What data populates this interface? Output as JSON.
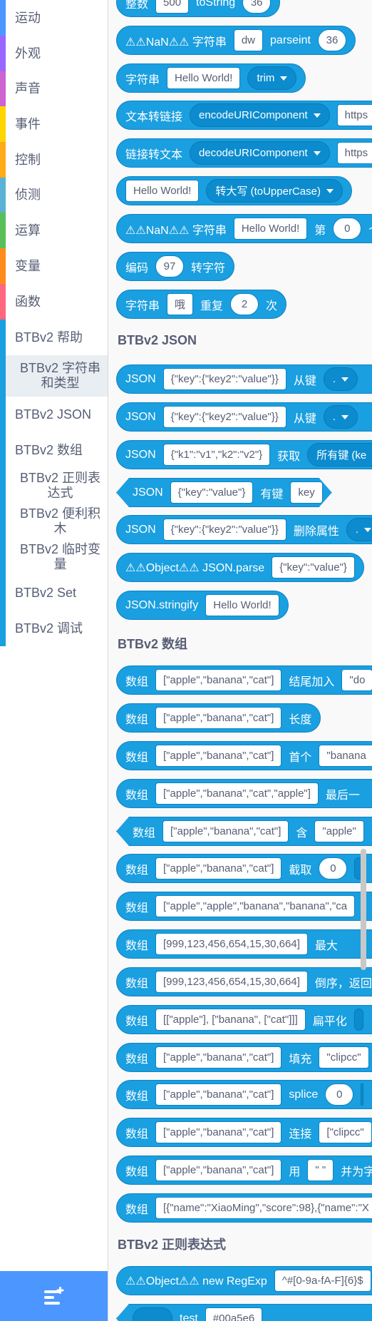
{
  "sidebar": {
    "categories": [
      {
        "label": "运动",
        "color": "#4c97ff"
      },
      {
        "label": "外观",
        "color": "#9966ff"
      },
      {
        "label": "声音",
        "color": "#cf63cf"
      },
      {
        "label": "事件",
        "color": "#ffd500"
      },
      {
        "label": "控制",
        "color": "#ffab19"
      },
      {
        "label": "侦测",
        "color": "#5cb1d6"
      },
      {
        "label": "运算",
        "color": "#59c059"
      },
      {
        "label": "变量",
        "color": "#ff8c1a"
      },
      {
        "label": "函数",
        "color": "#ff6680"
      },
      {
        "label": "BTBv2 帮助",
        "color": "#1a9fe0"
      },
      {
        "label": "BTBv2 字符串和类型",
        "color": "#1a9fe0"
      },
      {
        "label": "BTBv2 JSON",
        "color": "#1a9fe0"
      },
      {
        "label": "BTBv2 数组",
        "color": "#1a9fe0"
      },
      {
        "label": "BTBv2 正则表达式",
        "color": "#1a9fe0"
      },
      {
        "label": "BTBv2 便利积木",
        "color": "#1a9fe0"
      },
      {
        "label": "BTBv2 临时变量",
        "color": "#1a9fe0"
      },
      {
        "label": "BTBv2 Set",
        "color": "#1a9fe0"
      },
      {
        "label": "BTBv2 调试",
        "color": "#1a9fe0"
      }
    ],
    "extension_button_icon": "add-extension-icon"
  },
  "workspace": {
    "block_color": "#1a9fe0",
    "headers": {
      "json": "BTBv2 JSON",
      "array": "BTBv2 数组",
      "regex": "BTBv2 正则表达式"
    },
    "blocks": {
      "b0": {
        "t1": "整数",
        "f1": "500",
        "t2": "toString",
        "n1": "36"
      },
      "b1": {
        "t1": "⚠⚠NaN⚠⚠ 字符串",
        "f1": "dw",
        "t2": "parseint",
        "n1": "36"
      },
      "b2": {
        "t1": "字符串",
        "f1": "Hello World!",
        "d1": "trim"
      },
      "b3": {
        "t1": "文本转链接",
        "d1": "encodeURIComponent",
        "f1": "https"
      },
      "b4": {
        "t1": "链接转文本",
        "d1": "decodeURIComponent",
        "f1": "https"
      },
      "b5": {
        "f1": "Hello World!",
        "d1": "转大写 (toUpperCase)"
      },
      "b6": {
        "t1": "⚠⚠NaN⚠⚠ 字符串",
        "f1": "Hello World!",
        "t2": "第",
        "n1": "0",
        "t3": "个"
      },
      "b7": {
        "t1": "编码",
        "n1": "97",
        "t2": "转字符"
      },
      "b8": {
        "t1": "字符串",
        "f1": "哦",
        "t2": "重复",
        "n1": "2",
        "t3": "次"
      },
      "j0": {
        "t1": "JSON",
        "f1": "{\"key\":{\"key2\":\"value\"}}",
        "t2": "从键",
        "d1": "."
      },
      "j1": {
        "t1": "JSON",
        "f1": "{\"key\":{\"key2\":\"value\"}}",
        "t2": "从键",
        "d1": "."
      },
      "j2": {
        "t1": "JSON",
        "f1": "{\"k1\":\"v1\",\"k2\":\"v2\"}",
        "t2": "获取",
        "d1": "所有键 (ke"
      },
      "j3": {
        "t1": "JSON",
        "f1": "{\"key\":\"value\"}",
        "t2": "有键",
        "f2": "key"
      },
      "j4": {
        "t1": "JSON",
        "f1": "{\"key\":{\"key2\":\"value\"}}",
        "t2": "删除属性",
        "d1": "."
      },
      "j5": {
        "t1": "⚠⚠Object⚠⚠ JSON.parse",
        "f1": "{\"key\":\"value\"}"
      },
      "j6": {
        "t1": "JSON.stringify",
        "f1": "Hello World!"
      },
      "a0": {
        "t1": "数组",
        "f1": "[\"apple\",\"banana\",\"cat\"]",
        "t2": "结尾加入",
        "f2": "\"do"
      },
      "a1": {
        "t1": "数组",
        "f1": "[\"apple\",\"banana\",\"cat\"]",
        "t2": "长度"
      },
      "a2": {
        "t1": "数组",
        "f1": "[\"apple\",\"banana\",\"cat\"]",
        "t2": "首个",
        "f2": "\"banana"
      },
      "a3": {
        "t1": "数组",
        "f1": "[\"apple\",\"banana\",\"cat\",\"apple\"]",
        "t2": "最后一"
      },
      "a4": {
        "t1": "数组",
        "f1": "[\"apple\",\"banana\",\"cat\"]",
        "t2": "含",
        "f2": "\"apple\""
      },
      "a5": {
        "t1": "数组",
        "f1": "[\"apple\",\"banana\",\"cat\"]",
        "t2": "截取",
        "n1": "0"
      },
      "a6": {
        "t1": "数组",
        "f1": "[\"apple\",\"apple\",\"banana\",\"banana\",\"ca"
      },
      "a7": {
        "t1": "数组",
        "f1": "[999,123,456,654,15,30,664]",
        "t2": "最大"
      },
      "a8": {
        "t1": "数组",
        "f1": "[999,123,456,654,15,30,664]",
        "t2": "倒序，返回"
      },
      "a9": {
        "t1": "数组",
        "f1": "[[\"apple\"], [\"banana\", [\"cat\"]]]",
        "t2": "扁平化"
      },
      "a10": {
        "t1": "数组",
        "f1": "[\"apple\",\"banana\",\"cat\"]",
        "t2": "填充",
        "f2": "\"clipcc\""
      },
      "a11": {
        "t1": "数组",
        "f1": "[\"apple\",\"banana\",\"cat\"]",
        "t2": "splice",
        "n1": "0"
      },
      "a12": {
        "t1": "数组",
        "f1": "[\"apple\",\"banana\",\"cat\"]",
        "t2": "连接",
        "f2": "[\"clipcc\""
      },
      "a13": {
        "t1": "数组",
        "f1": "[\"apple\",\"banana\",\"cat\"]",
        "t2": "用",
        "f2": "\" \"",
        "t3": "并为字"
      },
      "a14": {
        "t1": "数组",
        "f1": "[{\"name\":\"XiaoMing\",\"score\":98},{\"name\":\"X"
      },
      "r0": {
        "t1": "⚠⚠Object⚠⚠ new RegExp",
        "f1": "^#[0-9a-fA-F]{6}$"
      },
      "r1": {
        "t1": "test",
        "f1": "#00a5e6"
      }
    }
  }
}
